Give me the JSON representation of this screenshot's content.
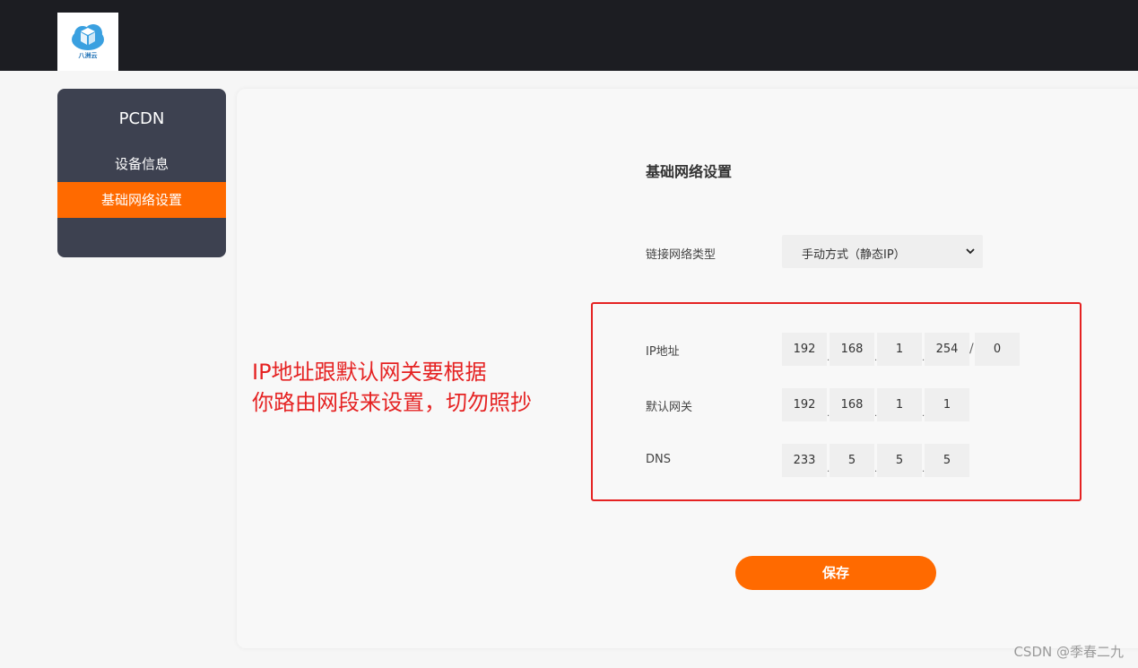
{
  "header": {
    "logo_text": "八洲云",
    "brand_color": "#ff6a00"
  },
  "sidebar": {
    "title": "PCDN",
    "items": [
      {
        "label": "设备信息",
        "active": false
      },
      {
        "label": "基础网络设置",
        "active": true
      }
    ]
  },
  "main": {
    "section_title": "基础网络设置",
    "connection_type": {
      "label": "链接网络类型",
      "selected": "手动方式（静态IP）"
    },
    "ip_address": {
      "label": "IP地址",
      "octets": [
        "192",
        "168",
        "1",
        "254"
      ],
      "mask": "0"
    },
    "gateway": {
      "label": "默认网关",
      "octets": [
        "192",
        "168",
        "1",
        "1"
      ]
    },
    "dns": {
      "label": "DNS",
      "octets": [
        "233",
        "5",
        "5",
        "5"
      ]
    },
    "save_label": "保存"
  },
  "annotation": {
    "line1": "IP地址跟默认网关要根据",
    "line2": "你路由网段来设置，切勿照抄",
    "color": "#e52222"
  },
  "watermark": "CSDN @季春二九"
}
